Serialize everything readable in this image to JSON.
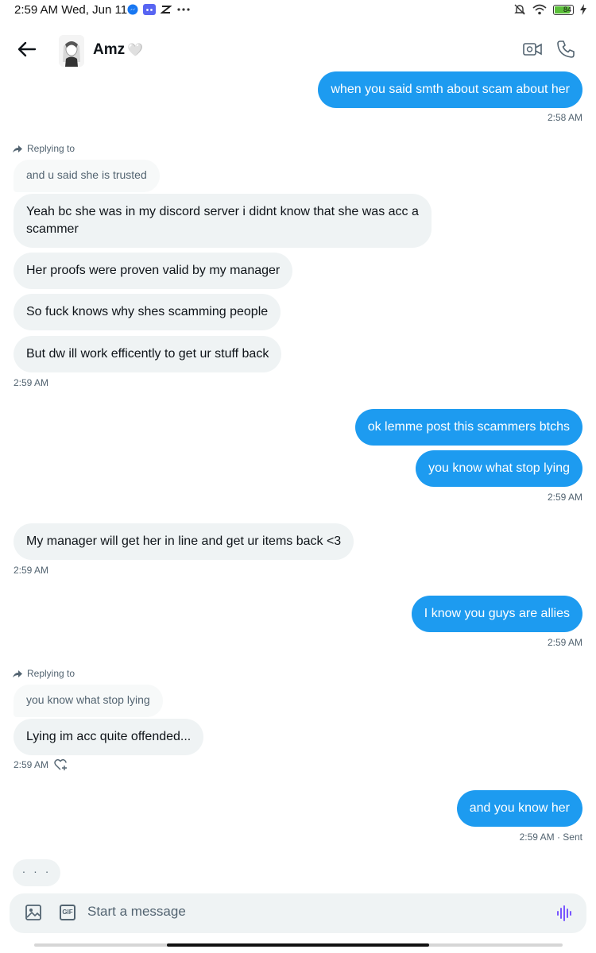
{
  "status_bar": {
    "time": "2:59 AM Wed, Jun 11",
    "battery": "84",
    "icons": [
      "messenger-icon",
      "discord-icon",
      "app-icon",
      "more-dots-icon",
      "bell-muted-icon",
      "wifi-icon",
      "battery-icon",
      "charging-icon"
    ]
  },
  "header": {
    "contact_name": "Amz",
    "heart": "🤍",
    "icons": [
      "back-arrow-icon",
      "video-call-icon",
      "phone-icon"
    ]
  },
  "messages": {
    "m1": {
      "text": "when you said smth about scam about her",
      "time": "2:58 AM"
    },
    "reply1": {
      "label": "Replying to",
      "quote": "and u said she is trusted"
    },
    "m2": {
      "text_line1": "Yeah bc she was in my discord server i didnt know that she was acc a",
      "text_line2": "scammer"
    },
    "m3": {
      "text": "Her proofs were proven valid by my manager"
    },
    "m4": {
      "text": "So fuck knows why shes scamming people"
    },
    "m5": {
      "text": "But dw ill work efficently to get ur stuff back",
      "time": "2:59 AM"
    },
    "m6": {
      "text": "ok lemme post this scammers btchs"
    },
    "m7": {
      "text": "you know what stop lying",
      "time": "2:59 AM"
    },
    "m8": {
      "text": "My manager will get her in line and get ur items back <3",
      "time": "2:59 AM"
    },
    "m9": {
      "text": "I know you guys are allies",
      "time": "2:59 AM"
    },
    "reply2": {
      "label": "Replying to",
      "quote": "you know what stop lying"
    },
    "m10": {
      "text": "Lying im acc quite offended...",
      "time": "2:59 AM"
    },
    "m11": {
      "text": "and you know her",
      "time": "2:59 AM · Sent"
    },
    "typing": "· · ·"
  },
  "composer": {
    "placeholder": "Start a message",
    "gif_label": "GIF"
  },
  "colors": {
    "outgoing": "#1d9bf0",
    "incoming": "#eff3f4",
    "voice_accent": "#7856ff"
  }
}
